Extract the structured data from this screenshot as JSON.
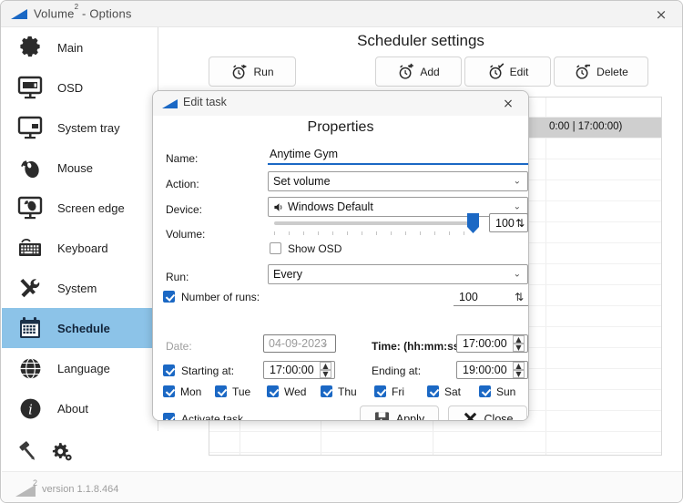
{
  "window": {
    "title": "Volume",
    "title_sup": "2",
    "title_rest": " - Options",
    "close_icon": "×"
  },
  "sidebar": {
    "items": [
      {
        "label": "Main",
        "icon": "gear-icon",
        "active": false
      },
      {
        "label": "OSD",
        "icon": "monitor-icon",
        "active": false
      },
      {
        "label": "System tray",
        "icon": "system-tray-icon",
        "active": false
      },
      {
        "label": "Mouse",
        "icon": "mouse-icon",
        "active": false
      },
      {
        "label": "Screen edge",
        "icon": "screen-edge-icon",
        "active": false
      },
      {
        "label": "Keyboard",
        "icon": "keyboard-icon",
        "active": false
      },
      {
        "label": "System",
        "icon": "tools-icon",
        "active": false
      },
      {
        "label": "Schedule",
        "icon": "calendar-icon",
        "active": true
      },
      {
        "label": "Language",
        "icon": "globe-icon",
        "active": false
      },
      {
        "label": "About",
        "icon": "info-icon",
        "active": false
      }
    ],
    "tools": [
      {
        "icon": "paint-roller-icon"
      },
      {
        "icon": "settings-gear-icon"
      }
    ]
  },
  "statusbar": {
    "sup": "2",
    "version": "version 1.1.8.464"
  },
  "content": {
    "page_title": "Scheduler settings",
    "toolbar": [
      {
        "label": "Run",
        "icon": "alarm-run-icon"
      },
      {
        "label": "Add",
        "icon": "alarm-add-icon"
      },
      {
        "label": "Edit",
        "icon": "alarm-edit-icon"
      },
      {
        "label": "Delete",
        "icon": "alarm-delete-icon"
      }
    ],
    "list": {
      "selected_row_text": "0:00 | 17:00:00)"
    },
    "bottom_buttons": [
      {
        "label": "Apply",
        "icon": "apply-icon",
        "disabled": true
      },
      {
        "label": "Close",
        "icon": "close-x-icon",
        "disabled": false
      }
    ]
  },
  "dialog": {
    "titlebar": {
      "title": "Edit task",
      "close_icon": "×"
    },
    "heading": "Properties",
    "fields": {
      "name_label": "Name:",
      "name_value": "Anytime Gym",
      "action_label": "Action:",
      "action_value": "Set volume",
      "device_label": "Device:",
      "device_value": "Windows Default",
      "device_icon": "speaker-icon",
      "volume_label": "Volume:",
      "volume_value": "100",
      "show_osd_label": "Show OSD",
      "show_osd_checked": false,
      "run_label": "Run:",
      "run_value": "Every",
      "number_of_runs_label": "Number of runs:",
      "number_of_runs_checked": true,
      "number_of_runs_value": "100",
      "date_label": "Date:",
      "date_value": "04-09-2023",
      "date_enabled": false,
      "time_label": "Time: (hh:mm:ss)",
      "time_value": "17:00:00",
      "starting_at_label": "Starting at:",
      "starting_at_checked": true,
      "starting_at_value": "17:00:00",
      "ending_at_label": "Ending at:",
      "ending_at_value": "19:00:00",
      "activate_task_label": "Activate task",
      "activate_task_checked": true
    },
    "days": [
      {
        "label": "Mon",
        "checked": true
      },
      {
        "label": "Tue",
        "checked": true
      },
      {
        "label": "Wed",
        "checked": true
      },
      {
        "label": "Thu",
        "checked": true
      },
      {
        "label": "Fri",
        "checked": true
      },
      {
        "label": "Sat",
        "checked": true
      },
      {
        "label": "Sun",
        "checked": true
      }
    ],
    "buttons": [
      {
        "label": "Apply",
        "icon": "apply-icon"
      },
      {
        "label": "Close",
        "icon": "close-x-icon"
      }
    ]
  },
  "colors": {
    "accent": "#1b68c4",
    "sidebar_active": "#8cc3e8",
    "selected_row": "#cfcfcf"
  }
}
